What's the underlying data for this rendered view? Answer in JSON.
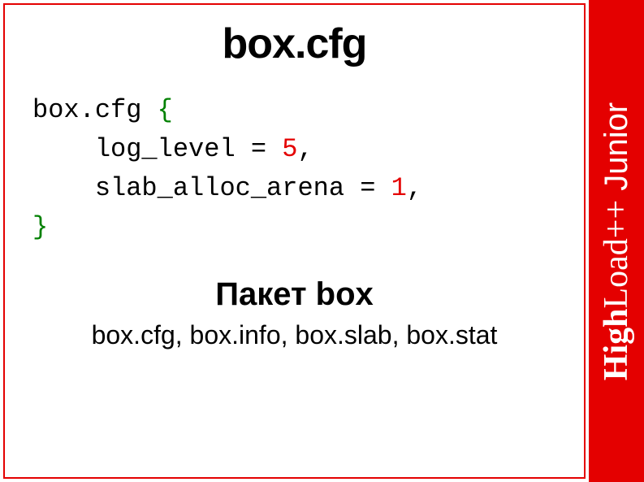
{
  "title": "box.cfg",
  "code": {
    "line1_a": "box.cfg ",
    "line1_b": "{",
    "line2_a": "    log_level = ",
    "line2_b": "5",
    "line2_c": ",",
    "line3_a": "    slab_alloc_arena = ",
    "line3_b": "1",
    "line3_c": ",",
    "line4": "}"
  },
  "section": {
    "title": "Пакет box",
    "body": "box.cfg, box.info, box.slab, box.stat"
  },
  "brand": {
    "high": "High",
    "load": "Load++",
    "junior": " Junior"
  }
}
